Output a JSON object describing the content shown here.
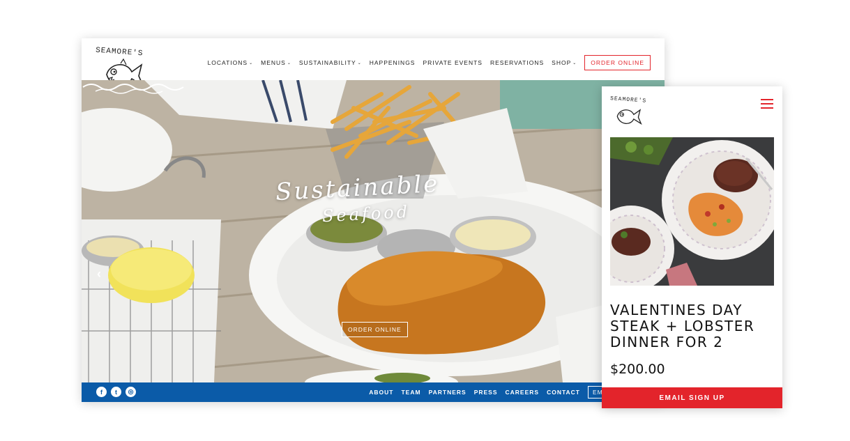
{
  "brand": {
    "logo_text": "SEAMORE'S",
    "accent_color": "#e3242b",
    "footer_color": "#0b5ba8"
  },
  "desktop": {
    "nav": [
      {
        "label": "LOCATIONS",
        "dropdown": true
      },
      {
        "label": "MENUS",
        "dropdown": true
      },
      {
        "label": "SUSTAINABILITY",
        "dropdown": true
      },
      {
        "label": "HAPPENINGS",
        "dropdown": false
      },
      {
        "label": "PRIVATE EVENTS",
        "dropdown": false
      },
      {
        "label": "RESERVATIONS",
        "dropdown": false
      },
      {
        "label": "SHOP",
        "dropdown": true
      }
    ],
    "order_button": "ORDER ONLINE",
    "hero": {
      "title": "Sustainable",
      "subtitle": "Seafood",
      "button": "ORDER ONLINE",
      "prev_arrow": "‹"
    },
    "footer": {
      "social": [
        {
          "icon": "facebook-icon",
          "glyph": "f"
        },
        {
          "icon": "twitter-icon",
          "glyph": "t"
        },
        {
          "icon": "instagram-icon",
          "glyph": "◎"
        }
      ],
      "links": [
        "ABOUT",
        "TEAM",
        "PARTNERS",
        "PRESS",
        "CAREERS",
        "CONTACT"
      ],
      "email_button": "EM"
    }
  },
  "mobile": {
    "menu_icon": "hamburger-menu-icon",
    "product_title": "VALENTINES DAY STEAK + LOBSTER DINNER FOR 2",
    "price": "$200.00",
    "signup_button": "EMAIL SIGN UP"
  }
}
